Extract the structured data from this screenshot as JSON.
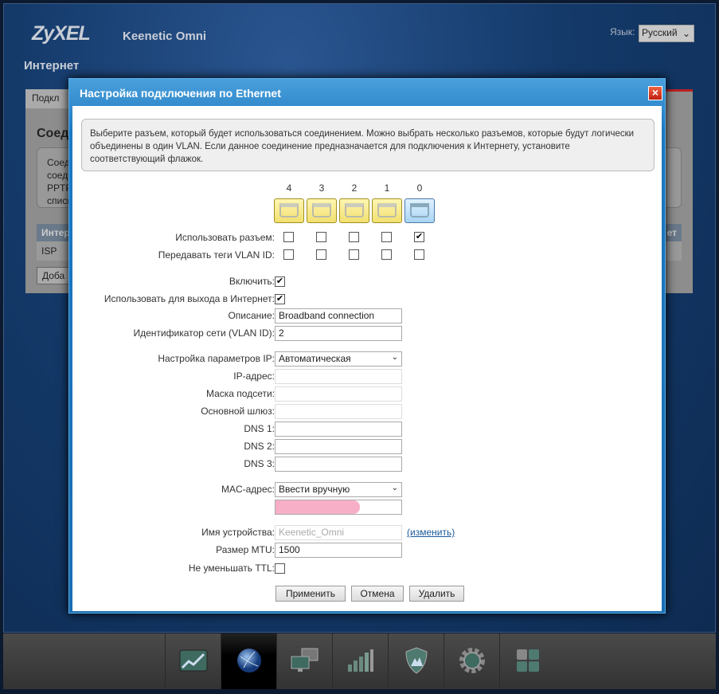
{
  "header": {
    "logo": "ZyXEL",
    "model": "Keenetic Omni",
    "language_label": "Язык:",
    "language_value": "Русский"
  },
  "page_title": "Интернет",
  "background": {
    "tab": "Подкл",
    "heading": "Соед",
    "info_lines": [
      "Соед",
      "соед",
      "PPTP",
      "списк"
    ],
    "table_header": "Интер",
    "table_header_right": "ет",
    "row": "ISP",
    "add_button": "Доба"
  },
  "modal": {
    "title": "Настройка подключения по Ethernet",
    "info": "Выберите разъем, который будет использоваться соединением. Можно выбрать несколько разъемов, которые будут логически объединены в один VLAN. Если данное соединение предназначается для подключения к Интернету, установите соответствующий флажок.",
    "ports": [
      {
        "n": "4",
        "use": false,
        "tag": false,
        "color": "yellow"
      },
      {
        "n": "3",
        "use": false,
        "tag": false,
        "color": "yellow"
      },
      {
        "n": "2",
        "use": false,
        "tag": false,
        "color": "yellow"
      },
      {
        "n": "1",
        "use": false,
        "tag": false,
        "color": "yellow"
      },
      {
        "n": "0",
        "use": true,
        "tag": false,
        "color": "blue"
      }
    ],
    "labels": {
      "use_port": "Использовать разъем:",
      "vlan_tags": "Передавать теги VLAN ID:",
      "enable": "Включить:",
      "internet": "Использовать для выхода в Интернет:",
      "description": "Описание:",
      "vlan_id": "Идентификатор сети (VLAN ID):",
      "ip_settings": "Настройка параметров IP:",
      "ip": "IP-адрес:",
      "mask": "Маска подсети:",
      "gateway": "Основной шлюз:",
      "dns1": "DNS 1:",
      "dns2": "DNS 2:",
      "dns3": "DNS 3:",
      "mac": "MAC-адрес:",
      "device_name": "Имя устройства:",
      "mtu": "Размер MTU:",
      "ttl": "Не уменьшать TTL:"
    },
    "values": {
      "enable": true,
      "internet": true,
      "description": "Broadband connection",
      "vlan_id": "2",
      "ip_settings": "Автоматическая",
      "ip": "",
      "mask": "",
      "gateway": "",
      "dns1": "",
      "dns2": "",
      "dns3": "",
      "mac_mode": "Ввести вручную",
      "mac": "",
      "device_name": "Keenetic_Omni",
      "mtu": "1500",
      "ttl": false
    },
    "change_link": "(изменить)",
    "buttons": {
      "apply": "Применить",
      "cancel": "Отмена",
      "delete": "Удалить"
    }
  },
  "dock": [
    "chart-icon",
    "globe-icon",
    "network-icon",
    "signal-icon",
    "shield-icon",
    "gear-icon",
    "apps-icon"
  ],
  "dock_active": 1
}
